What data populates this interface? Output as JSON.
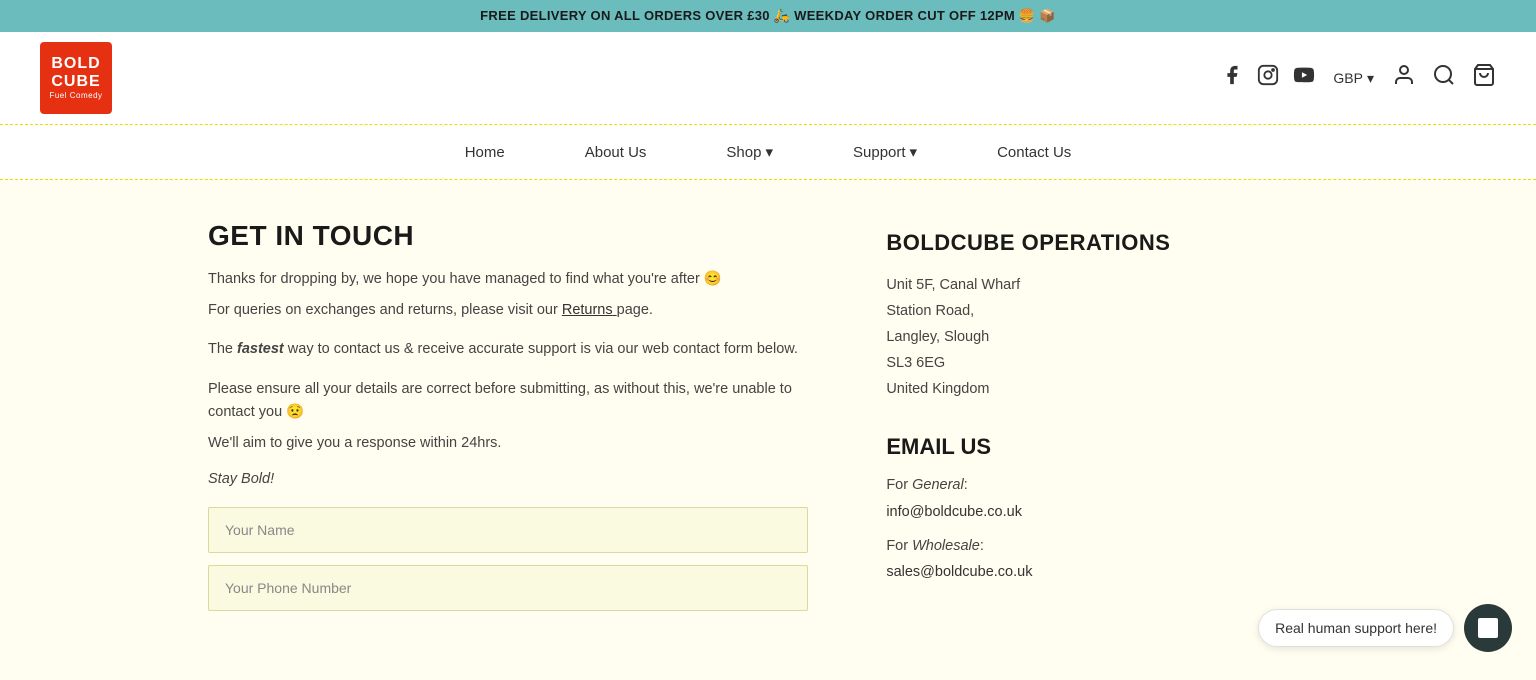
{
  "announcement": {
    "text": "FREE DELIVERY ON ALL ORDERS OVER £30 🛵  WEEKDAY ORDER CUT OFF 12PM 🍔 📦"
  },
  "header": {
    "logo": {
      "line1": "BOLD",
      "line2": "CUBE",
      "sub": "Fuel Comedy"
    },
    "social": {
      "facebook": "f",
      "instagram": "ig",
      "youtube": "yt"
    },
    "currency": {
      "label": "GBP",
      "chevron": "▾"
    },
    "icons": {
      "account": "👤",
      "search": "🔍",
      "cart": "🛍"
    }
  },
  "nav": {
    "items": [
      {
        "label": "Home",
        "hasDropdown": false
      },
      {
        "label": "About Us",
        "hasDropdown": false
      },
      {
        "label": "Shop",
        "hasDropdown": true
      },
      {
        "label": "Support",
        "hasDropdown": true
      },
      {
        "label": "Contact Us",
        "hasDropdown": false
      }
    ]
  },
  "contact": {
    "title": "GET IN TOUCH",
    "intro1": "Thanks for dropping by, we hope you have managed to find what you're after 😊",
    "intro2": "For queries on exchanges and returns, please visit our",
    "returns_link": "Returns",
    "intro2_end": " page.",
    "fastest_text1": "The ",
    "fastest_word": "fastest",
    "fastest_text2": " way to contact us & receive accurate support is via our web contact form below.",
    "ensure_text": "Please ensure all your details are correct before submitting, as without this, we're unable to contact you 😟",
    "response_text": "We'll aim to give you a response within 24hrs.",
    "stay_bold": "Stay Bold!",
    "form": {
      "name_placeholder": "Your Name",
      "phone_placeholder": "Your Phone Number"
    }
  },
  "operations": {
    "title": "BOLDCUBE OPERATIONS",
    "address": {
      "line1": "Unit 5F, Canal Wharf",
      "line2": "Station Road,",
      "line3": "Langley, Slough",
      "line4": "SL3 6EG",
      "line5": "United Kingdom"
    }
  },
  "email": {
    "title": "EMAIL US",
    "general_label": "For General:",
    "general_italic": "General",
    "general_email": "info@boldcube.co.uk",
    "wholesale_label": "For Wholesale:",
    "wholesale_italic": "Wholesale",
    "wholesale_email": "sales@boldcube.co.uk"
  },
  "chat": {
    "label": "Real human support here!"
  }
}
